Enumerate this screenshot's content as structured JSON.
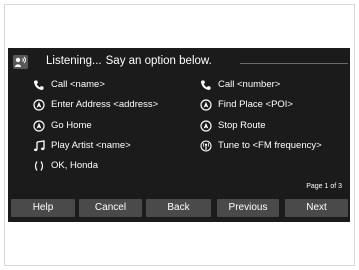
{
  "header": {
    "status": "Listening...",
    "prompt": "Say an option below."
  },
  "options": [
    {
      "label": "Call <name>",
      "icon": "phone-icon"
    },
    {
      "label": "Call <number>",
      "icon": "phone-icon"
    },
    {
      "label": "Enter Address <address>",
      "icon": "navigation-icon"
    },
    {
      "label": "Find Place <POI>",
      "icon": "navigation-icon"
    },
    {
      "label": "Go Home",
      "icon": "navigation-icon"
    },
    {
      "label": "Stop Route",
      "icon": "navigation-icon"
    },
    {
      "label": "Play Artist <name>",
      "icon": "music-note-icon"
    },
    {
      "label": "Tune to <FM frequency>",
      "icon": "radio-icon"
    },
    {
      "label": "OK, Honda",
      "icon": "ok-icon"
    }
  ],
  "page_indicator": "Page 1 of 3",
  "buttons": {
    "help": "Help",
    "cancel": "Cancel",
    "back": "Back",
    "previous": "Previous",
    "next": "Next"
  },
  "colors": {
    "screen_bg": "#1b1b1b",
    "text": "#ffffff",
    "button_bg": "#4a4a4a"
  }
}
